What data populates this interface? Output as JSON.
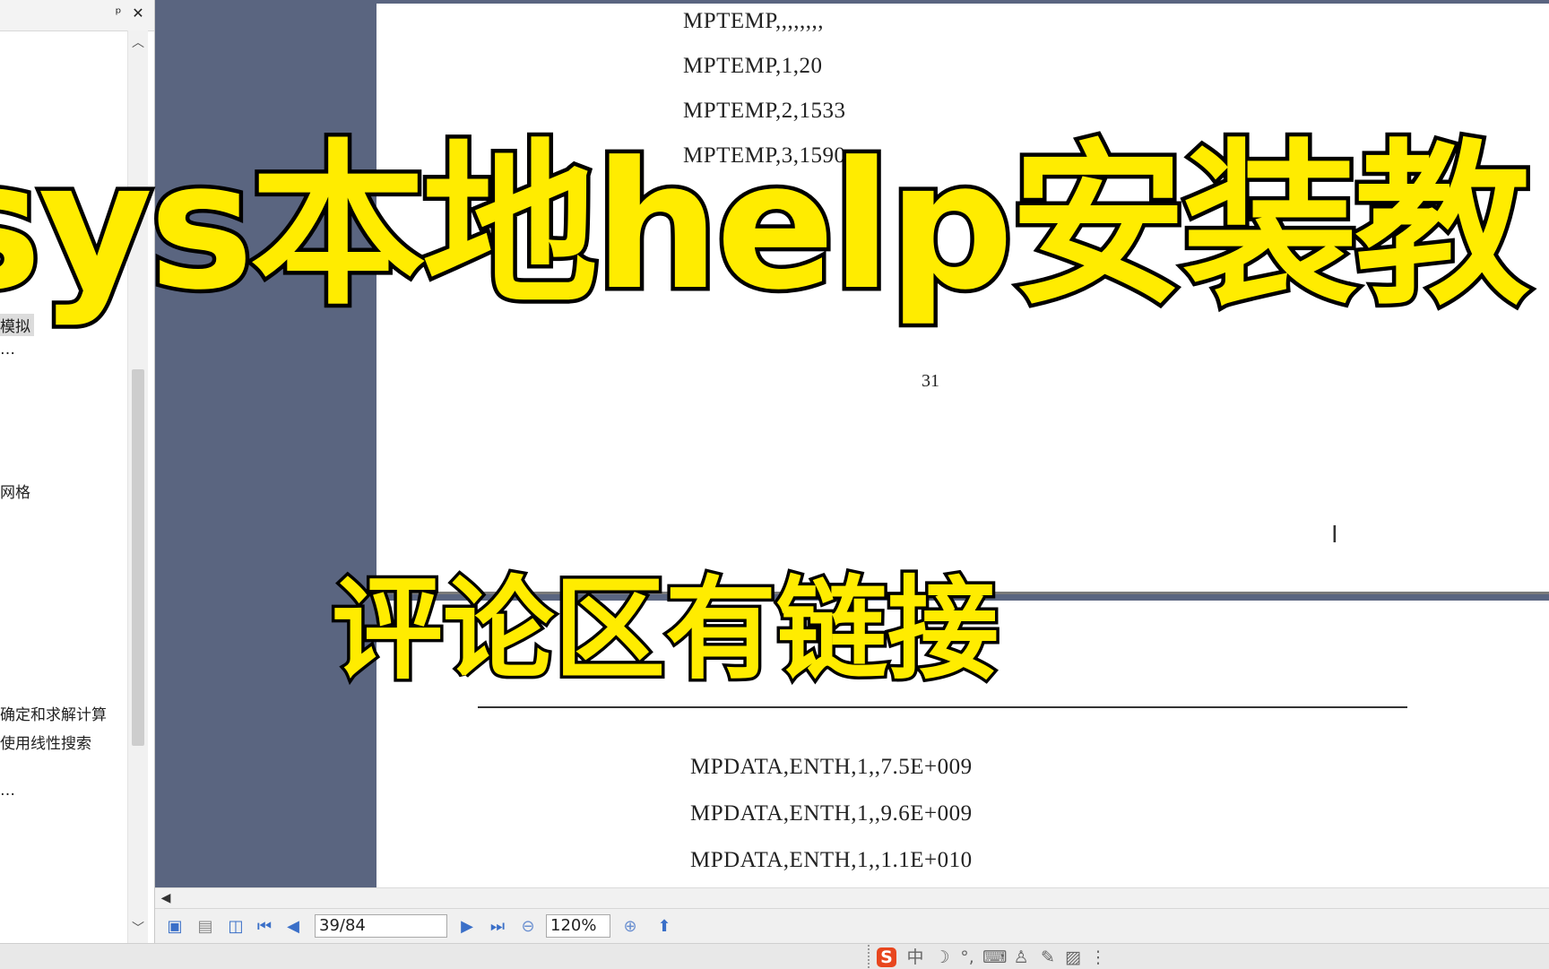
{
  "left_pane": {
    "pin_label": "ᵖ",
    "close_label": "✕",
    "items": [
      {
        "label": "模拟"
      },
      {
        "label": "…"
      },
      {
        "label": "网格"
      },
      {
        "label": "确定和求解计算"
      },
      {
        "label": "使用线性搜索"
      },
      {
        "label": "…"
      }
    ]
  },
  "document": {
    "page1_lines": [
      "MPTEMP,,,,,,,,",
      "MPTEMP,1,20",
      "MPTEMP,2,1533",
      "MPTEMP,3,1590"
    ],
    "page_number": "31",
    "page2_lines": [
      "MPDATA,ENTH,1,,7.5E+009",
      "MPDATA,ENTH,1,,9.6E+009",
      "MPDATA,ENTH,1,,1.1E+010"
    ],
    "cursor_glyph": "I"
  },
  "toolbar": {
    "page_field": "39/84",
    "zoom_field": "120%"
  },
  "overlay": {
    "title": "sys本地help安装教",
    "subtitle": "评论区有链接"
  },
  "ime": {
    "brand": "S",
    "mode": "中"
  },
  "colors": {
    "viewer_background": "#5a6580",
    "caption_fill": "#ffec00",
    "caption_stroke": "#000000"
  }
}
